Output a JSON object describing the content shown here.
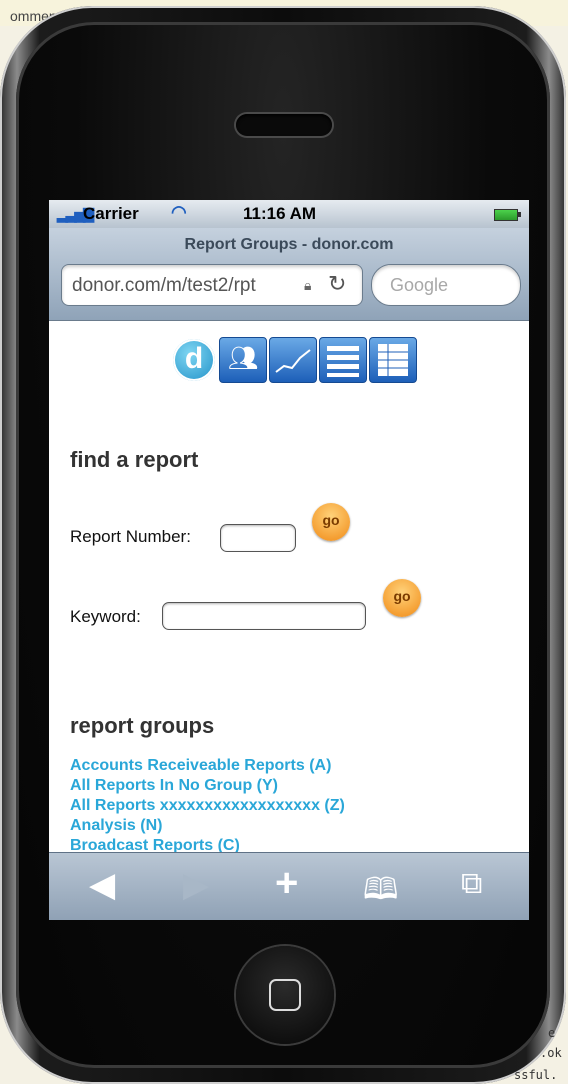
{
  "background": {
    "top_text": "ommen",
    "corner_texts": [
      "e",
      ".ok",
      "ssful."
    ]
  },
  "status_bar": {
    "carrier": "Carrier",
    "time": "11:16 AM"
  },
  "browser": {
    "page_title": "Report Groups - donor.com",
    "url": "donor.com/m/test2/rpt",
    "search_placeholder": "Google"
  },
  "find_report": {
    "heading": "find a report",
    "report_number_label": "Report Number:",
    "report_number_value": "",
    "keyword_label": "Keyword:",
    "keyword_value": "",
    "go_label": "go"
  },
  "report_groups": {
    "heading": "report groups",
    "items": [
      "Accounts Receiveable Reports (A)",
      "All Reports In No Group (Y)",
      "All Reports xxxxxxxxxxxxxxxxxx (Z)",
      "Analysis (N)",
      "Broadcast Reports (C)"
    ]
  },
  "logo": {
    "letter": "d"
  },
  "icons": {
    "status": [
      "signal-icon",
      "wifi-icon",
      "battery-icon"
    ],
    "logo_tiles": [
      "people-icon",
      "chart-icon",
      "list-icon",
      "table-icon"
    ],
    "toolbar": [
      "back-icon",
      "forward-icon",
      "add-icon",
      "bookmarks-icon",
      "pages-icon"
    ]
  },
  "colors": {
    "link": "#2aa7d8",
    "go_button": "#f08a16",
    "toolbar": "#8fa1b5"
  }
}
